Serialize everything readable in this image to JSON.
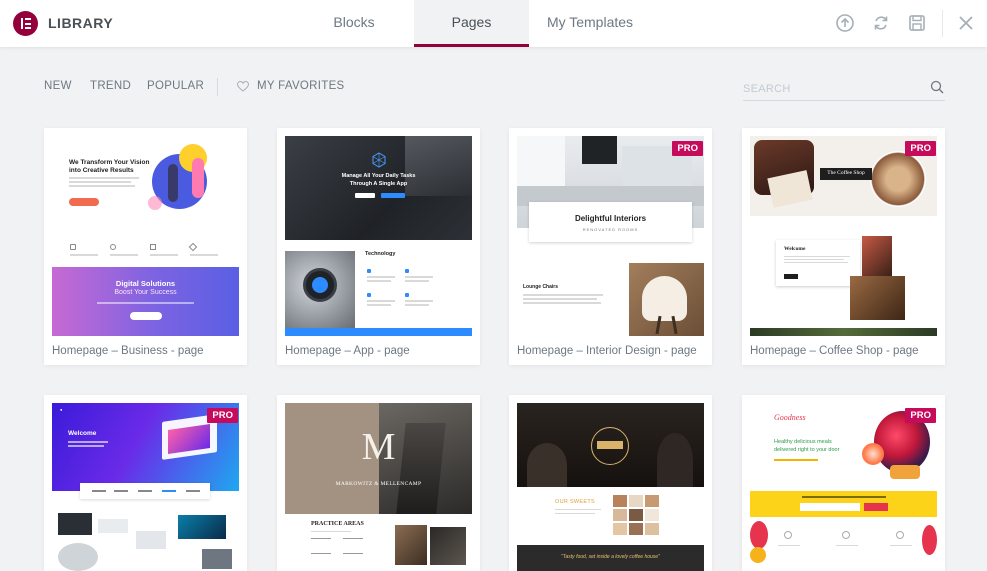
{
  "header": {
    "brand": "LIBRARY",
    "tabs": [
      {
        "label": "Blocks",
        "active": false
      },
      {
        "label": "Pages",
        "active": true
      },
      {
        "label": "My Templates",
        "active": false
      }
    ],
    "icons": [
      "upload-icon",
      "sync-icon",
      "save-icon",
      "close-icon"
    ],
    "accent": "#93003c"
  },
  "filters": {
    "items": [
      "NEW",
      "TREND",
      "POPULAR"
    ],
    "favorites": "MY FAVORITES",
    "search_placeholder": "SEARCH"
  },
  "cards": [
    {
      "title": "Homepage – Business - page",
      "pro": false,
      "thumb": {
        "headline_1": "We Transform Your Vision",
        "headline_2": "into Creative Results",
        "band_title": "Digital Solutions",
        "band_subtitle": "Boost Your Success"
      }
    },
    {
      "title": "Homepage – App - page",
      "pro": false,
      "thumb": {
        "headline_1": "Manage All Your Daily Tasks",
        "headline_2": "Through A Single App",
        "section": "Technology"
      }
    },
    {
      "title": "Homepage – Interior Design - page",
      "pro": true,
      "thumb": {
        "headline": "Delightful Interiors",
        "subline": "RENOVATED ROOMS",
        "section": "Lounge Chairs"
      }
    },
    {
      "title": "Homepage – Coffee Shop - page",
      "pro": true,
      "thumb": {
        "headline": "The Coffee Shop",
        "section": "Welcome"
      }
    },
    {
      "title": "",
      "pro": true,
      "thumb": {
        "headline": "Welcome"
      }
    },
    {
      "title": "",
      "pro": false,
      "thumb": {
        "monogram": "M",
        "headline": "MARKOWITZ & MELLENCAMP",
        "section": "PRACTICE AREAS"
      }
    },
    {
      "title": "",
      "pro": false,
      "thumb": {
        "section": "OUR SWEETS",
        "quote": "\"Tasty food, set inside a lovely coffee house\""
      }
    },
    {
      "title": "",
      "pro": true,
      "thumb": {
        "brand": "Goodness",
        "headline_1": "Healthy delicious meals",
        "headline_2": "delivered right to your door"
      }
    }
  ],
  "pro_label": "PRO"
}
